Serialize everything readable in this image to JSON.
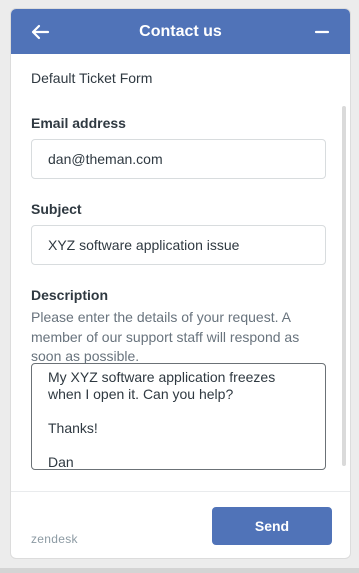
{
  "colors": {
    "brand": "#5073b8",
    "text": "#2f3941",
    "hint": "#68737d",
    "border": "#d8dcde"
  },
  "header": {
    "title": "Contact us",
    "back_icon": "arrow-left-icon",
    "minimize_icon": "minus-icon"
  },
  "form": {
    "name": "Default Ticket Form",
    "email": {
      "label": "Email address",
      "value": "dan@theman.com"
    },
    "subject": {
      "label": "Subject",
      "value": "XYZ software application issue"
    },
    "description": {
      "label": "Description",
      "hint": "Please enter the details of your request. A member of our support staff will respond as soon as possible.",
      "value": "My XYZ software application freezes when I open it. Can you help?\n\nThanks!\n\nDan"
    }
  },
  "footer": {
    "logo": "zendesk",
    "send_label": "Send"
  }
}
